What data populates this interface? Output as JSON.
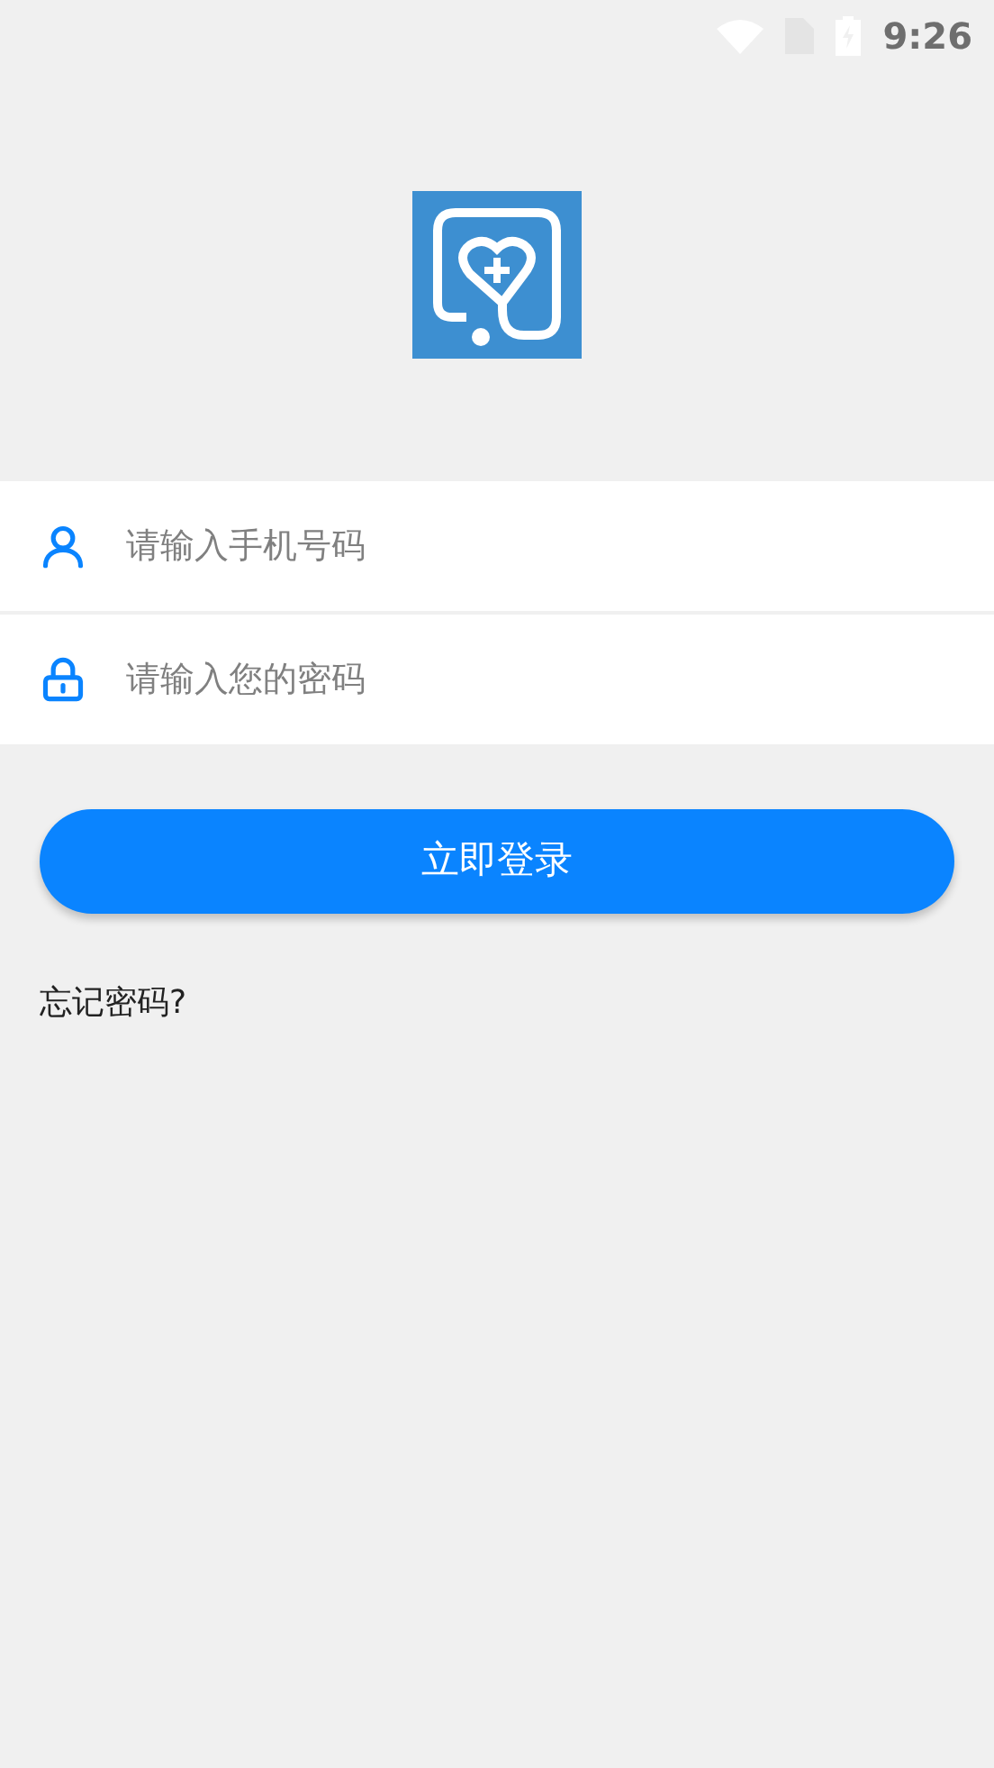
{
  "status_bar": {
    "time": "9:26"
  },
  "fields": [
    {
      "kind": "phone",
      "placeholder": "请输入手机号码"
    },
    {
      "kind": "password",
      "placeholder": "请输入您的密码"
    }
  ],
  "login_button": "立即登录",
  "forgot_link": "忘记密码?"
}
